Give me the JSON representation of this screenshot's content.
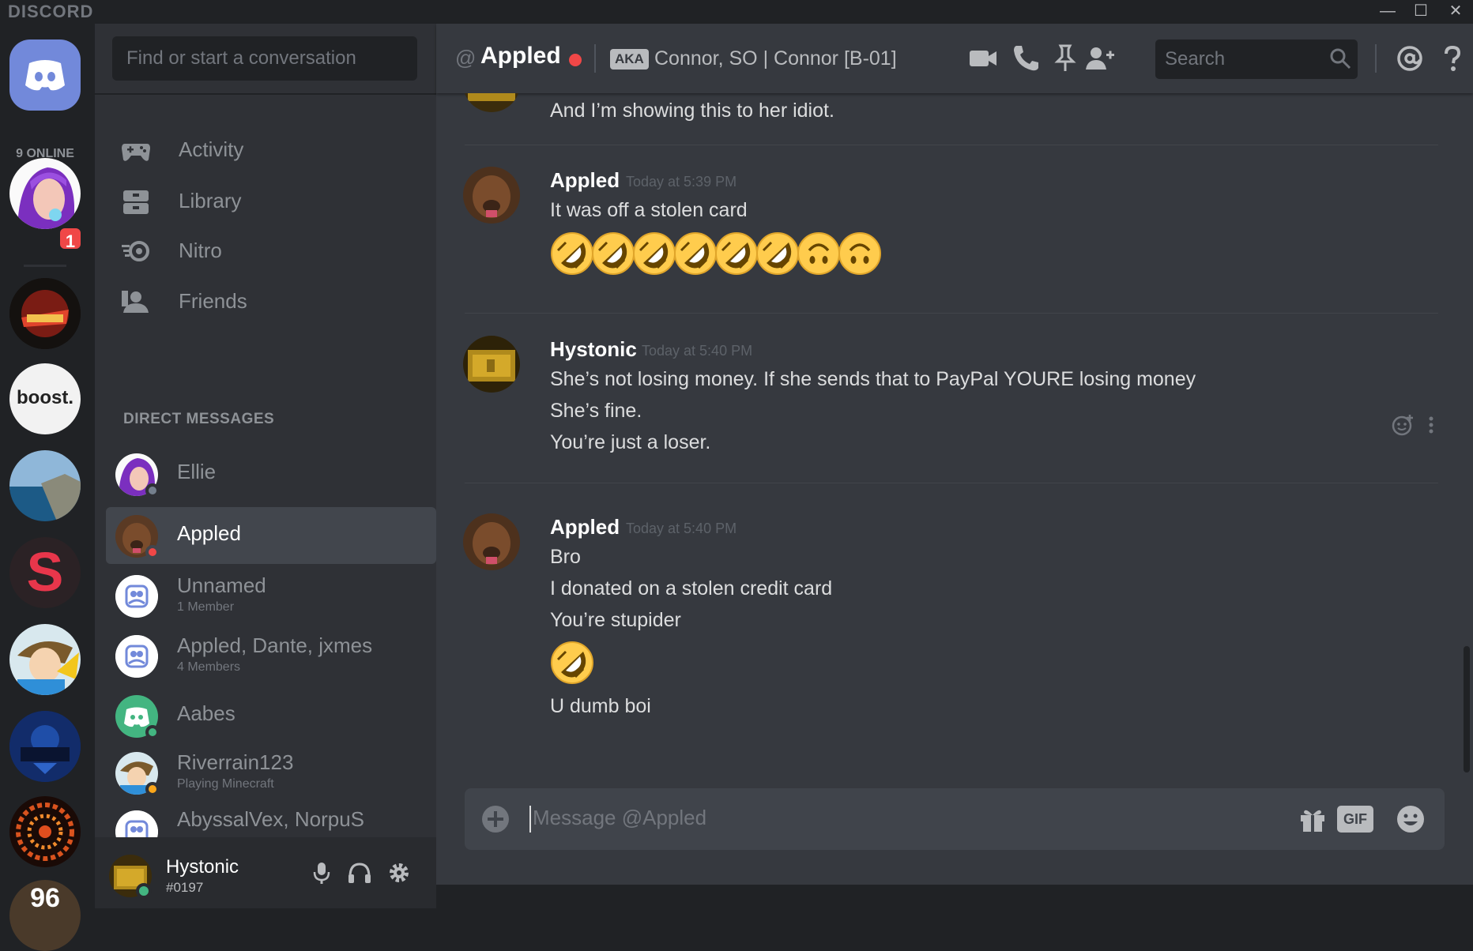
{
  "app": {
    "brand": "DISCORD",
    "window_controls": {
      "minimize": "—",
      "maximize": "☐",
      "close": "✕"
    }
  },
  "servers": {
    "online_count": "9 ONLINE",
    "mention_badge": "1",
    "boost_label": "boost.",
    "partial_label": "96"
  },
  "sidebar": {
    "search_placeholder": "Find or start a conversation",
    "nav": [
      {
        "label": "Activity",
        "icon": "gamepad-icon"
      },
      {
        "label": "Library",
        "icon": "library-icon"
      },
      {
        "label": "Nitro",
        "icon": "nitro-icon"
      },
      {
        "label": "Friends",
        "icon": "friends-icon"
      }
    ],
    "dm_header": "DIRECT MESSAGES",
    "dms": [
      {
        "name": "Ellie",
        "sub": "",
        "status": "offline"
      },
      {
        "name": "Appled",
        "sub": "",
        "status": "dnd"
      },
      {
        "name": "Unnamed",
        "sub": "1 Member",
        "status": ""
      },
      {
        "name": "Appled, Dante, jxmes",
        "sub": "4 Members",
        "status": ""
      },
      {
        "name": "Aabes",
        "sub": "",
        "status": "online"
      },
      {
        "name": "Riverrain123",
        "sub": "Playing Minecraft",
        "status": "idle"
      },
      {
        "name": "AbyssalVex, NorpuS",
        "sub": "",
        "status": ""
      }
    ],
    "user": {
      "name": "Hystonic",
      "tag": "#0197"
    }
  },
  "header": {
    "at_symbol": "@",
    "channel_name": "Appled",
    "aka_badge": "AKA",
    "aka_names": "Connor, SO | Connor [B-01]",
    "search_placeholder": "Search"
  },
  "messages": {
    "partial_line": "And I’m showing this to her idiot.",
    "groups": [
      {
        "author": "Appled",
        "time": "Today at 5:39 PM",
        "lines": [
          "It was off a stolen card"
        ],
        "emojis": [
          "rofl",
          "rofl",
          "rofl",
          "rofl",
          "rofl",
          "rofl",
          "upside-down",
          "upside-down"
        ]
      },
      {
        "author": "Hystonic",
        "time": "Today at 5:40 PM",
        "lines": [
          "She’s not losing money. If she sends that to PayPal YOURE losing money",
          "She’s fine.",
          "You’re just a loser."
        ]
      },
      {
        "author": "Appled",
        "time": "Today at 5:40 PM",
        "lines": [
          "Bro",
          "I donated on a stolen credit card",
          "You’re stupider"
        ],
        "emojis": [
          "rofl"
        ],
        "after": "U dumb boi"
      }
    ]
  },
  "composer": {
    "placeholder": "Message @Appled",
    "gif_label": "GIF"
  },
  "colors": {
    "blurple": "#7289da",
    "dnd": "#f04747",
    "online": "#43b581",
    "idle": "#faa61a",
    "offline": "#747f8d"
  }
}
